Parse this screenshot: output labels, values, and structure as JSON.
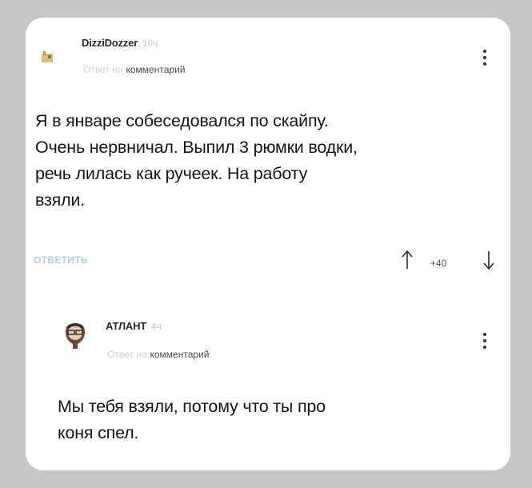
{
  "comments": [
    {
      "author": "DizziDozzer",
      "time": "10ч",
      "reply_prefix": "Ответ на",
      "reply_word": "комментарий",
      "text_lines": [
        "Я в январе собеседовался по скайпу.",
        "Очень нервничал. Выпил 3 рюмки водки,",
        "речь лилась как ручеек. На работу",
        "взяли."
      ],
      "reply_label": "ОТВЕТИТЬ",
      "rating": "+40",
      "icons": [
        "avatar-icon",
        "more-vert-icon",
        "arrow-up-icon",
        "arrow-down-icon"
      ]
    },
    {
      "author": "АТЛАНТ",
      "time": "4ч",
      "reply_prefix": "Ответ на",
      "reply_word": "комментарий",
      "text_lines": [
        "Мы тебя взяли, потому что ты про",
        "коня спел."
      ],
      "icons": [
        "avatar-icon",
        "more-vert-icon"
      ]
    }
  ],
  "colors": {
    "background": "#c9c6c7",
    "card": "#ffffff",
    "text": "#161616",
    "muted": "#d0d0d0",
    "reply_button": "#b4cfe0"
  }
}
